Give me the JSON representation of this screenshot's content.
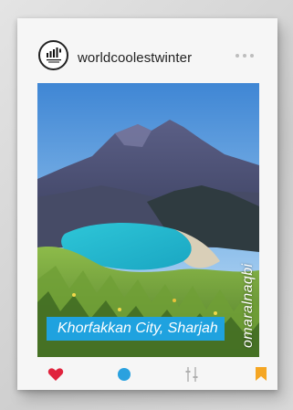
{
  "post": {
    "username": "worldcoolestwinter",
    "avatar_icon": "brand-logo-icon",
    "caption": "Khorfakkan City, Sharjah",
    "photo_credit": "omaralnaqbi"
  },
  "actions": [
    {
      "name": "like",
      "icon": "heart-icon",
      "color": "#e0233d"
    },
    {
      "name": "comment",
      "icon": "comment-bubble-icon",
      "color": "#2aa1df"
    },
    {
      "name": "share",
      "icon": "filter-sliders-icon",
      "color": "#bdbdbd"
    },
    {
      "name": "save",
      "icon": "bookmark-icon",
      "color": "#f5a623"
    }
  ],
  "colors": {
    "caption_bg": "#1fa2df",
    "card_bg": "#f6f6f6"
  }
}
